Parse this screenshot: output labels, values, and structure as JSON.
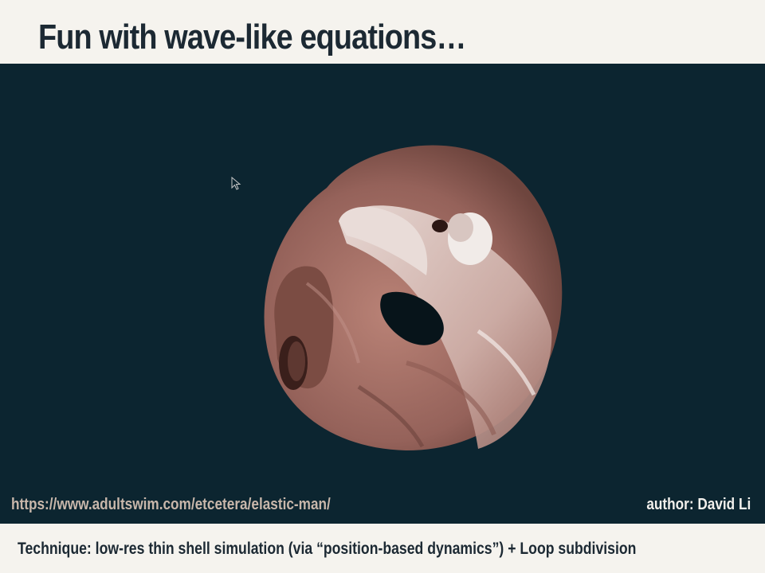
{
  "slide": {
    "title": "Fun with wave-like equations…",
    "url": "https://www.adultswim.com/etcetera/elastic-man/",
    "author": "author: David Li",
    "technique": "Technique: low-res thin shell simulation (via “position-based dynamics”) + Loop subdivision"
  },
  "colors": {
    "stage_background": "#0c2530",
    "title_text": "#1c2933",
    "url_text": "#c8b7ab",
    "author_text": "#f2f0ec",
    "blob_dark": "#7a4d44",
    "blob_mid": "#a9766b",
    "blob_light": "#e6d4cf"
  },
  "icons": {
    "cursor": "mouse-pointer-icon"
  }
}
